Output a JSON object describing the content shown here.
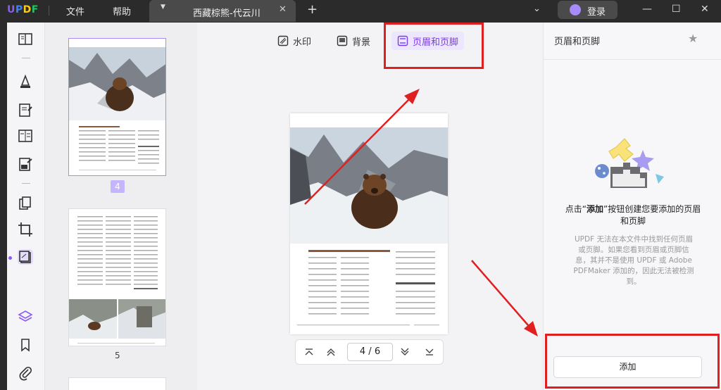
{
  "app": {
    "logo": "UPDF",
    "menu": [
      "文件",
      "帮助"
    ],
    "tab_title": "西藏棕熊-代云川",
    "login": "登录"
  },
  "toolbar": {
    "watermark": "水印",
    "background": "背景",
    "header_footer": "页眉和页脚"
  },
  "thumbnails": {
    "pages": [
      "4",
      "5"
    ],
    "selected": "4"
  },
  "navigator": {
    "current": "4",
    "separator": "/",
    "total": "6"
  },
  "right_panel": {
    "title": "页眉和页脚",
    "message_prefix": "点击“",
    "message_bold": "添加",
    "message_suffix": "”按钮创建您要添加的页眉和页脚",
    "sub": "UPDF 无法在本文件中找到任何页眉或页脚。如果您看到页眉或页脚信息，其并不是使用 UPDF 或 Adobe PDFMaker 添加的，因此无法被检测到。",
    "add_button": "添加"
  },
  "colors": {
    "accent": "#8b5cf6",
    "annotation": "#e02020"
  }
}
